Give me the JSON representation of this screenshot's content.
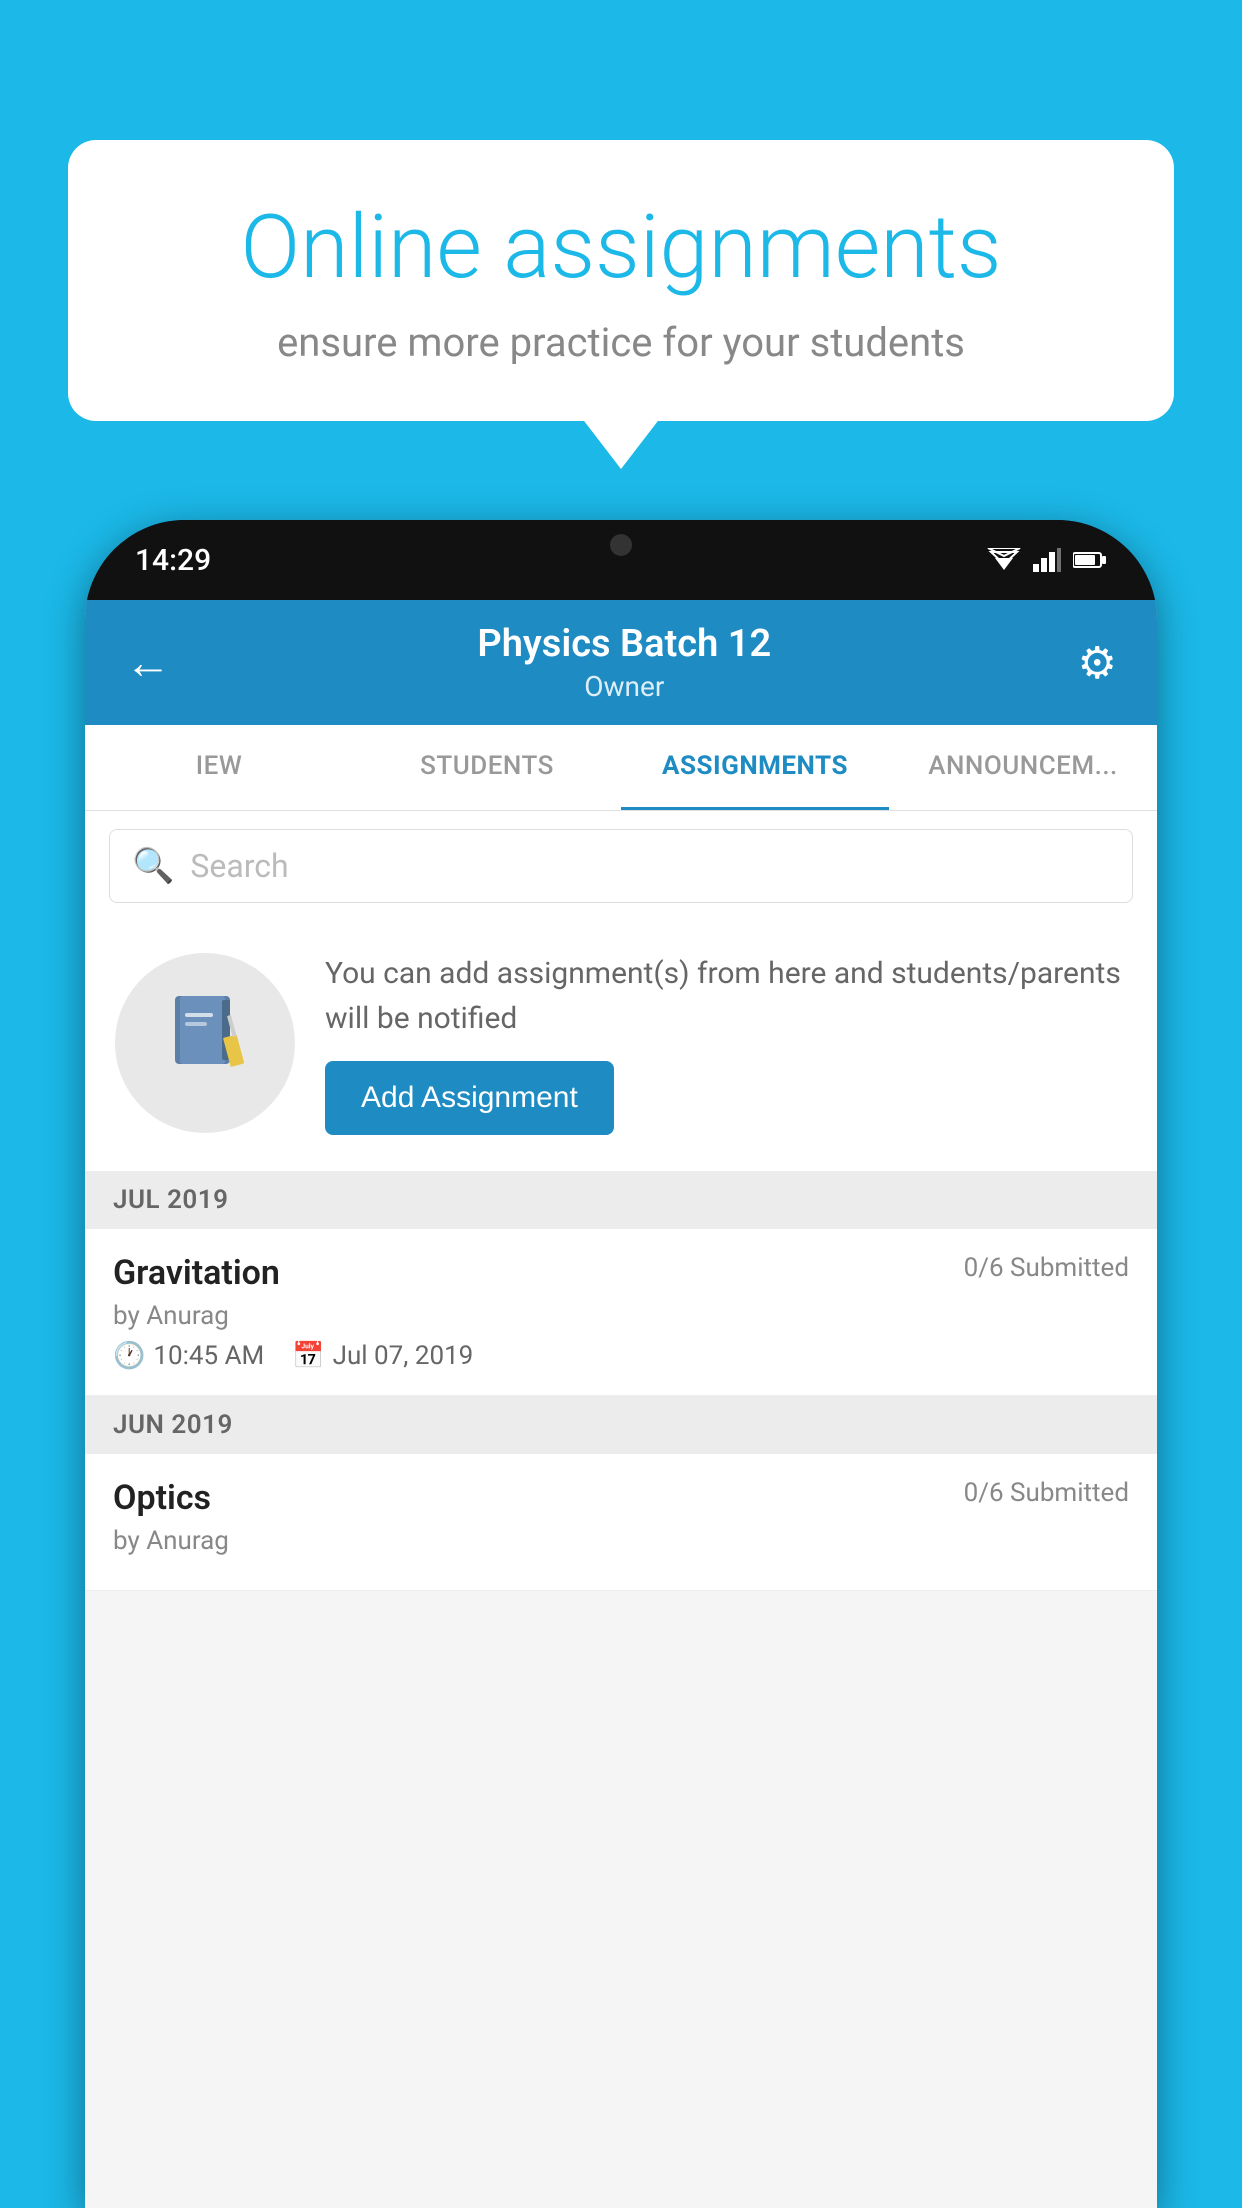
{
  "background_color": "#1bb8e8",
  "speech_bubble": {
    "title": "Online assignments",
    "subtitle": "ensure more practice for your students"
  },
  "phone": {
    "status_bar": {
      "time": "14:29"
    },
    "header": {
      "title": "Physics Batch 12",
      "subtitle": "Owner",
      "back_label": "←",
      "settings_label": "⚙"
    },
    "tabs": [
      {
        "label": "IEW",
        "active": false
      },
      {
        "label": "STUDENTS",
        "active": false
      },
      {
        "label": "ASSIGNMENTS",
        "active": true
      },
      {
        "label": "ANNOUNCEM...",
        "active": false
      }
    ],
    "search": {
      "placeholder": "Search"
    },
    "empty_block": {
      "description": "You can add assignment(s) from here and students/parents will be notified",
      "button_label": "Add Assignment"
    },
    "sections": [
      {
        "label": "JUL 2019",
        "assignments": [
          {
            "name": "Gravitation",
            "submitted": "0/6 Submitted",
            "by": "by Anurag",
            "time": "10:45 AM",
            "date": "Jul 07, 2019"
          }
        ]
      },
      {
        "label": "JUN 2019",
        "assignments": [
          {
            "name": "Optics",
            "submitted": "0/6 Submitted",
            "by": "by Anurag",
            "time": "",
            "date": ""
          }
        ]
      }
    ]
  }
}
